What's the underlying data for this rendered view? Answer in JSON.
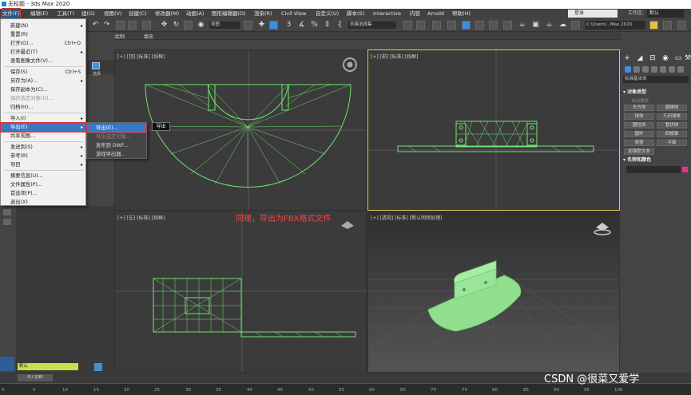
{
  "window": {
    "title": "无标题 - 3ds Max 2020"
  },
  "menubar": {
    "items": [
      "文件(F)",
      "编辑(E)",
      "工具(T)",
      "组(G)",
      "视图(V)",
      "创建(C)",
      "修改器(M)",
      "动画(A)",
      "图形编辑器(D)",
      "渲染(R)",
      "Civil View",
      "自定义(U)",
      "脚本(S)",
      "Interactive",
      "内容",
      "Arnold",
      "帮助(H)"
    ],
    "login": "登录",
    "workspace_label": "工作区:",
    "workspace_value": "默认"
  },
  "toolbar": {
    "view_combo": "视图",
    "selection_set": "创建选择集",
    "path": "C:\\Users\\...Max 2020"
  },
  "ribbon": {
    "items": [
      "对象绘制",
      "填充"
    ]
  },
  "scene_explorer": {
    "dropdown": "选择"
  },
  "file_menu": {
    "items": [
      {
        "label": "新建(N)",
        "arrow": "▸"
      },
      {
        "label": "重置(R)"
      },
      {
        "label": "打开(O)...",
        "shortcut": "Ctrl+O"
      },
      {
        "label": "打开最近(T)",
        "arrow": "▸"
      },
      {
        "label": "查看图像文件(V)..."
      },
      {
        "label": "保存(S)",
        "shortcut": "Ctrl+S"
      },
      {
        "label": "另存为(A)...",
        "arrow": "▸"
      },
      {
        "label": "保存副本为(C)..."
      },
      {
        "label": "保存选定对象(D)..."
      },
      {
        "label": "归档(H)..."
      },
      {
        "label": "导入(I)",
        "arrow": "▸"
      },
      {
        "label": "导出(E)",
        "arrow": "▸"
      },
      {
        "label": "共享视图..."
      },
      {
        "label": "发送到(S)",
        "arrow": "▸"
      },
      {
        "label": "参考(R)",
        "arrow": "▸"
      },
      {
        "label": "项目",
        "arrow": "▸"
      },
      {
        "label": "摘要信息(U)..."
      },
      {
        "label": "文件属性(P)..."
      },
      {
        "label": "首选项(P)..."
      },
      {
        "label": "退出(X)"
      }
    ]
  },
  "export_submenu": {
    "items": [
      "导出(E)...",
      "导出选定对象...",
      "发布到 DWF...",
      "游戏导出器..."
    ],
    "tooltip": "导出"
  },
  "viewports": {
    "top_label": "[+] [顶] [标准] [线框]",
    "front_label": "[+] [前] [标准] [线框]",
    "left_label": "[+] [左] [标准] [线框]",
    "persp_label": "[+] [透视] [标准] [默认明暗处理]"
  },
  "annotation": "同理，导出为FBX格式文件",
  "command_panel": {
    "dropdown": "标准基本体",
    "object_type": "对象类型",
    "autogrid": "自动栅格",
    "buttons": [
      "长方体",
      "圆锥体",
      "球体",
      "几何球体",
      "圆柱体",
      "管状体",
      "圆环",
      "四棱锥",
      "茶壶",
      "平面",
      "加强型文本"
    ],
    "name_color": "名称和颜色"
  },
  "timeline": {
    "slider": "0 / 100",
    "ticks": [
      "0",
      "5",
      "10",
      "15",
      "20",
      "25",
      "30",
      "35",
      "40",
      "45",
      "50",
      "55",
      "60",
      "65",
      "70",
      "75",
      "80",
      "85",
      "90",
      "95",
      "100"
    ]
  },
  "status": {
    "field": "默认"
  },
  "watermark": "CSDN @很菜又爱学",
  "colors": {
    "accent": "#3a78c4",
    "highlight": "#e03030",
    "wire": "#6fe36f",
    "model_fill": "#8fdf8f",
    "annotation": "#ff4040"
  }
}
